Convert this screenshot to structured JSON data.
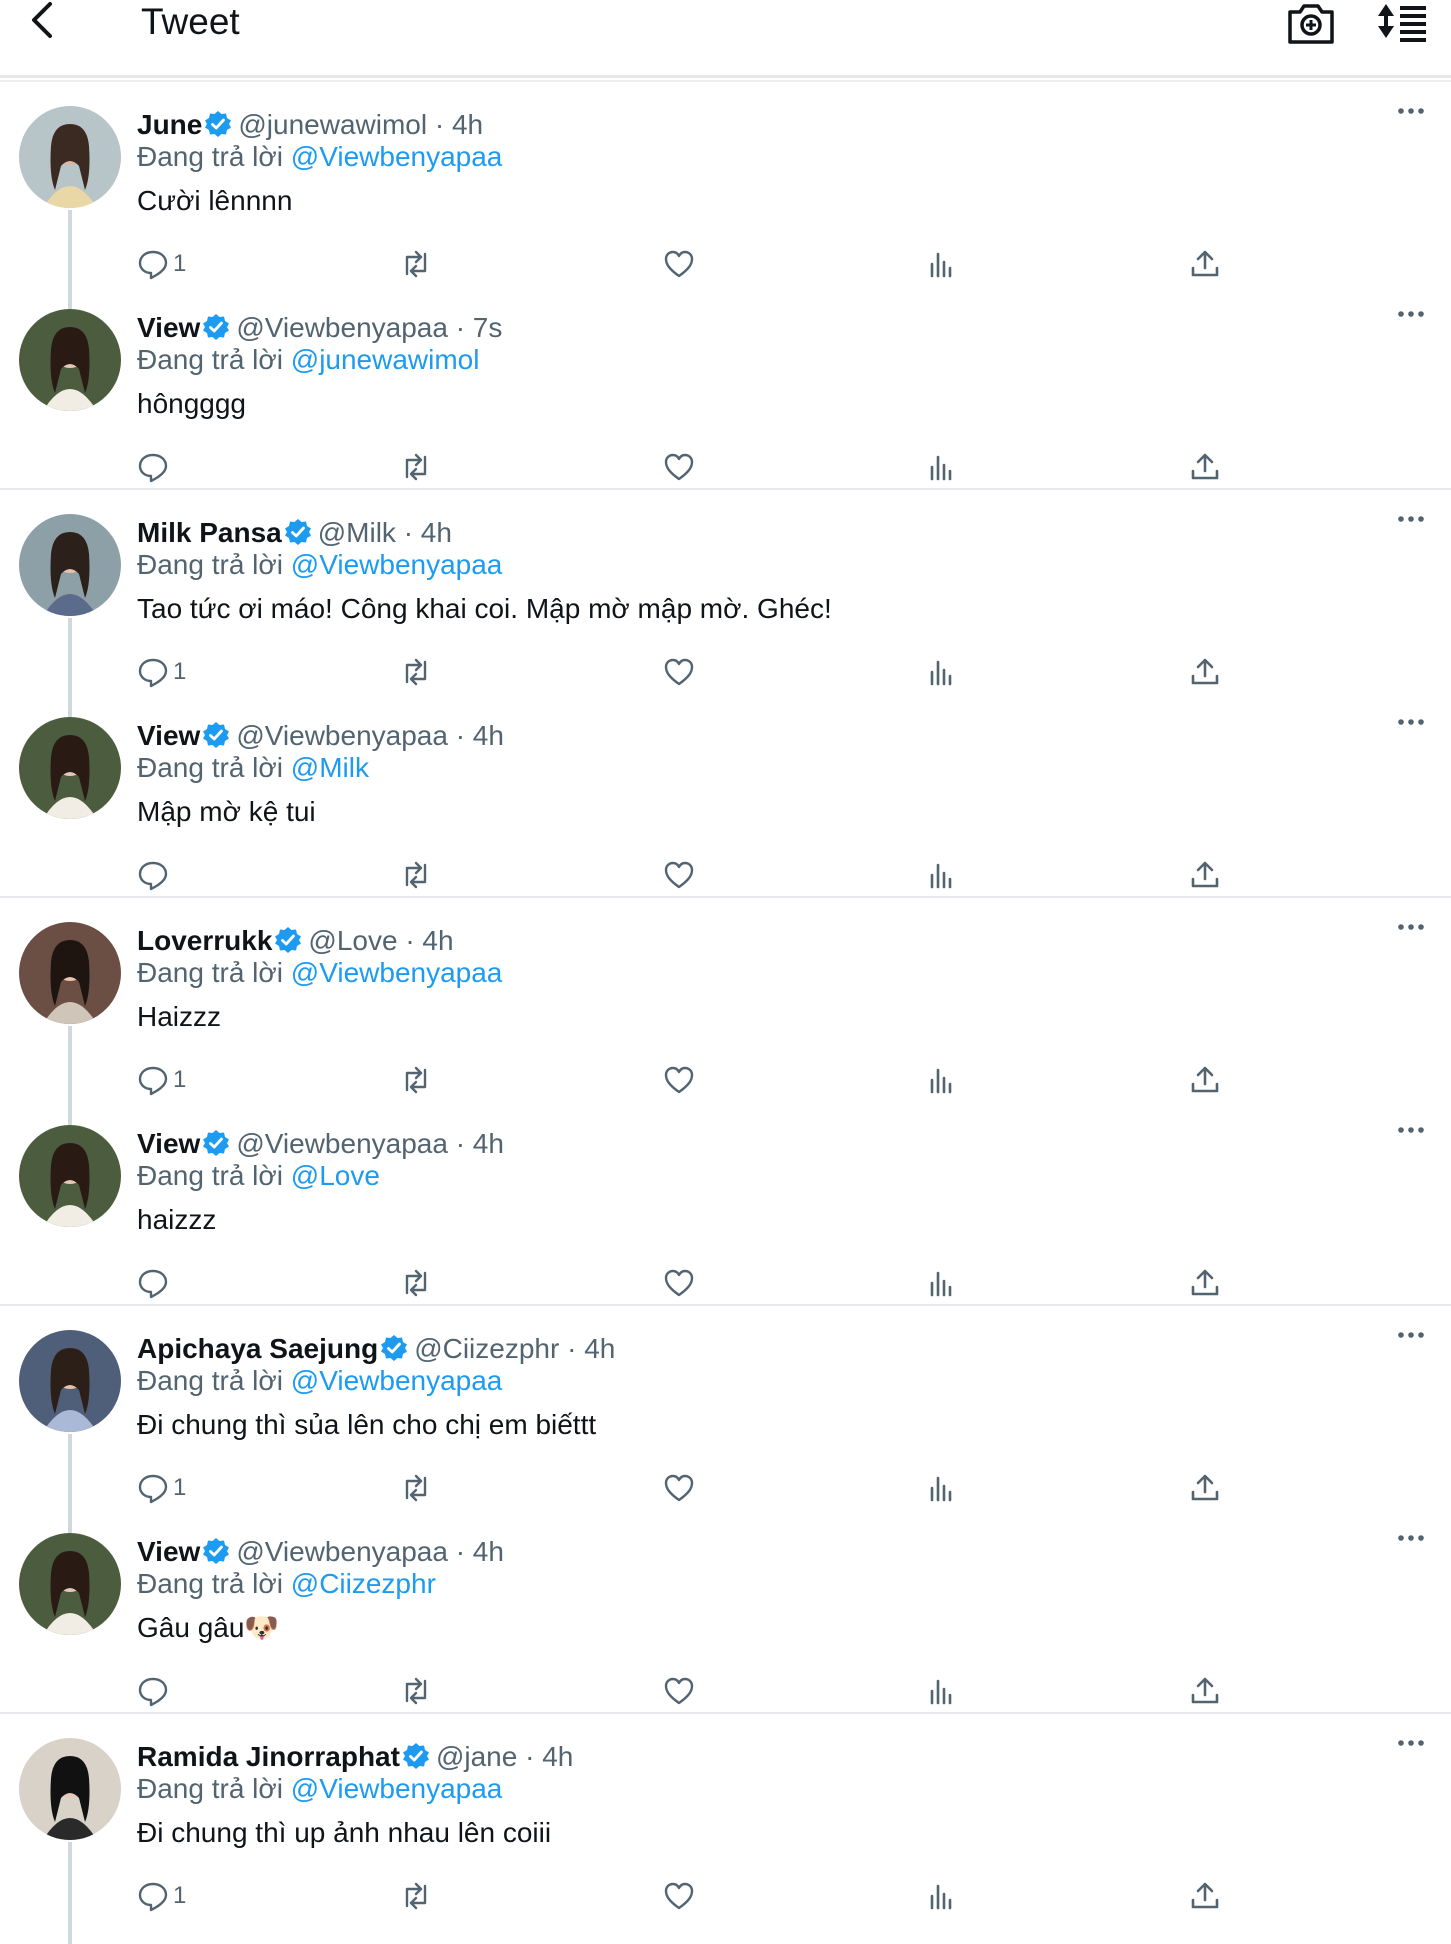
{
  "header": {
    "title": "Tweet",
    "back_icon": "chevron-left-icon",
    "camera_icon": "camera-icon",
    "sort_icon": "sort-icon"
  },
  "colors": {
    "link": "#1d9bf0",
    "verified": "#1d9bf0",
    "muted": "#536471",
    "divider": "#e6e8eb"
  },
  "reply_prefix": "Đang trả lời",
  "groups": [
    {
      "tweets": [
        {
          "name": "June",
          "handle": "@junewawimol · 4h",
          "reply_to": "@Viewbenyapaa",
          "text": "Cười lênnnn",
          "reply_count": "1"
        },
        {
          "name": "View",
          "handle": "@Viewbenyapaa · 7s",
          "reply_to": "@junewawimol",
          "text": "hôngggg",
          "reply_count": ""
        }
      ]
    },
    {
      "tweets": [
        {
          "name": "Milk Pansa",
          "handle": "@Milk · 4h",
          "reply_to": "@Viewbenyapaa",
          "text": "Tao tức ơi máo! Công khai coi. Mập mờ mập mờ. Ghéc!",
          "reply_count": "1"
        },
        {
          "name": "View",
          "handle": "@Viewbenyapaa · 4h",
          "reply_to": "@Milk",
          "text": "Mập mờ kệ tui",
          "reply_count": ""
        }
      ]
    },
    {
      "tweets": [
        {
          "name": "Loverrukk",
          "handle": "@Love · 4h",
          "reply_to": "@Viewbenyapaa",
          "text": "Haizzz",
          "reply_count": "1"
        },
        {
          "name": "View",
          "handle": "@Viewbenyapaa · 4h",
          "reply_to": "@Love",
          "text": "haizzz",
          "reply_count": ""
        }
      ]
    },
    {
      "tweets": [
        {
          "name": "Apichaya Saejung",
          "handle": "@Ciizezphr · 4h",
          "reply_to": "@Viewbenyapaa",
          "text": "Đi chung thì sủa lên cho chị em biếttt",
          "reply_count": "1"
        },
        {
          "name": "View",
          "handle": "@Viewbenyapaa · 4h",
          "reply_to": "@Ciizezphr",
          "text": "Gâu gâu🐶",
          "reply_count": ""
        }
      ]
    },
    {
      "tweets": [
        {
          "name": "Ramida Jinorraphat",
          "handle": "@jane · 4h",
          "reply_to": "@Viewbenyapaa",
          "text": "Đi chung thì up ảnh nhau lên coiii",
          "reply_count": "1"
        }
      ]
    }
  ]
}
